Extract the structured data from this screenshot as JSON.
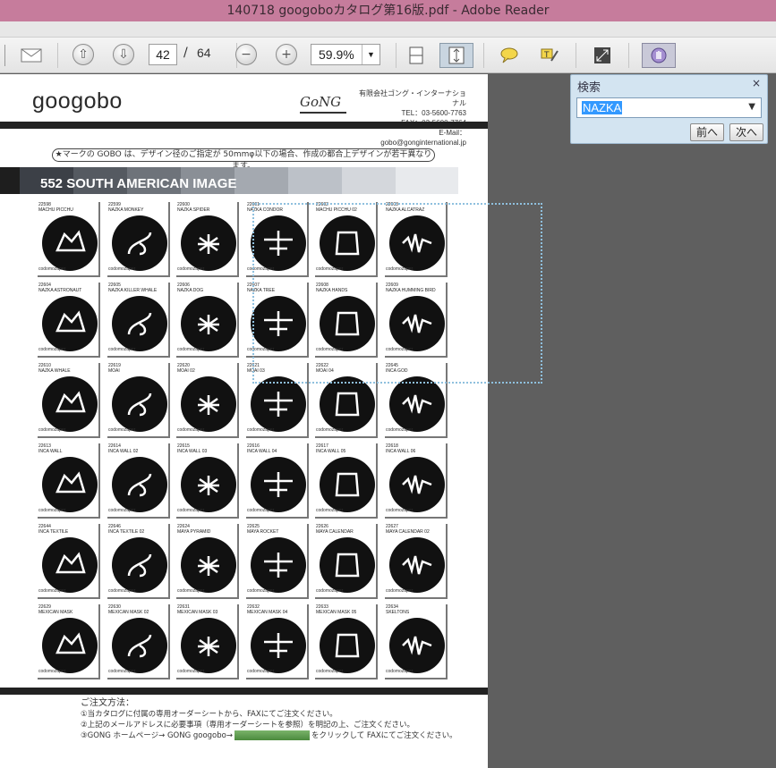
{
  "window": {
    "title": "140718 googoboカタログ第16版.pdf - Adobe Reader"
  },
  "toolbar": {
    "current_page": "42",
    "page_separator": "/",
    "total_pages": "64",
    "zoom": "59.9%"
  },
  "search_panel": {
    "title": "検索",
    "close": "×",
    "query": "NAZKA",
    "prev_label": "前へ",
    "next_label": "次へ"
  },
  "document": {
    "logo": "googobo",
    "company_logo": "GoNG",
    "contact": [
      "有限会社ゴング・インターナショナル",
      "TEL：03-5600-7763",
      "FAX：03-5600-7764",
      "E-Mail：gobo@gonginternational.jp"
    ],
    "notice": "★マークの GOBO は、デザイン径のご指定が 50mmφ以下の場合、作成の都合上デザインが若干異なります。",
    "section_title": "552 SOUTH AMERICAN IMAGE",
    "maker": "codomozaper",
    "footer": {
      "title": "ご注文方法：",
      "lines": [
        "①当カタログに付属の専用オーダーシートから、FAXにてご注文ください。",
        "②上記のメールアドレスに必要事項（専用オーダーシートを参照）を明記の上、ご注文ください。",
        "③GONG ホームページ→ GONG googobo→",
        "をクリックして FAXにてご注文ください。"
      ]
    },
    "gobos": [
      {
        "num": "22598",
        "name": "MACHU PICCHU"
      },
      {
        "num": "22599",
        "name": "NAZKA MONKEY"
      },
      {
        "num": "22600",
        "name": "NAZKA SPIDER"
      },
      {
        "num": "22601",
        "name": "NAZKA CONDOR"
      },
      {
        "num": "22602",
        "name": "MACHU PICCHU 02"
      },
      {
        "num": "22603",
        "name": "NAZKA ALCATRAZ"
      },
      {
        "num": "22604",
        "name": "NAZKA ASTRONAUT"
      },
      {
        "num": "22605",
        "name": "NAZKA KILLER WHALE"
      },
      {
        "num": "22606",
        "name": "NAZKA DOG"
      },
      {
        "num": "22607",
        "name": "NAZKA TREE"
      },
      {
        "num": "22608",
        "name": "NAZKA HANDS"
      },
      {
        "num": "22609",
        "name": "NAZKA HUMMING BIRD"
      },
      {
        "num": "22610",
        "name": "NAZKA WHALE"
      },
      {
        "num": "22619",
        "name": "MOAI"
      },
      {
        "num": "22620",
        "name": "MOAI 02"
      },
      {
        "num": "22621",
        "name": "MOAI 03"
      },
      {
        "num": "22622",
        "name": "MOAI 04"
      },
      {
        "num": "22645",
        "name": "INCA GOD"
      },
      {
        "num": "22613",
        "name": "INCA WALL"
      },
      {
        "num": "22614",
        "name": "INCA WALL 02"
      },
      {
        "num": "22615",
        "name": "INCA WALL 03"
      },
      {
        "num": "22616",
        "name": "INCA WALL 04"
      },
      {
        "num": "22617",
        "name": "INCA WALL 05"
      },
      {
        "num": "22618",
        "name": "INCA WALL 06"
      },
      {
        "num": "22644",
        "name": "INCA TEXTILE"
      },
      {
        "num": "22646",
        "name": "INCA TEXTILE 02"
      },
      {
        "num": "22624",
        "name": "MAYA PYRAMID"
      },
      {
        "num": "22625",
        "name": "MAYA ROCKET"
      },
      {
        "num": "22626",
        "name": "MAYA CALENDAR"
      },
      {
        "num": "22627",
        "name": "MAYA CALENDAR 02"
      },
      {
        "num": "22629",
        "name": "MEXICAN MASK"
      },
      {
        "num": "22630",
        "name": "MEXICAN MASK 02"
      },
      {
        "num": "22631",
        "name": "MEXICAN MASK 03"
      },
      {
        "num": "22632",
        "name": "MEXICAN MASK 04"
      },
      {
        "num": "22633",
        "name": "MEXICAN MASK 05"
      },
      {
        "num": "22634",
        "name": "SKELTONS"
      }
    ]
  },
  "colors": {
    "titlebar": "#c67c9c",
    "viewer_bg": "#5f5f5f",
    "search_panel": "#d3e4f1",
    "highlight": "#3399ff"
  }
}
